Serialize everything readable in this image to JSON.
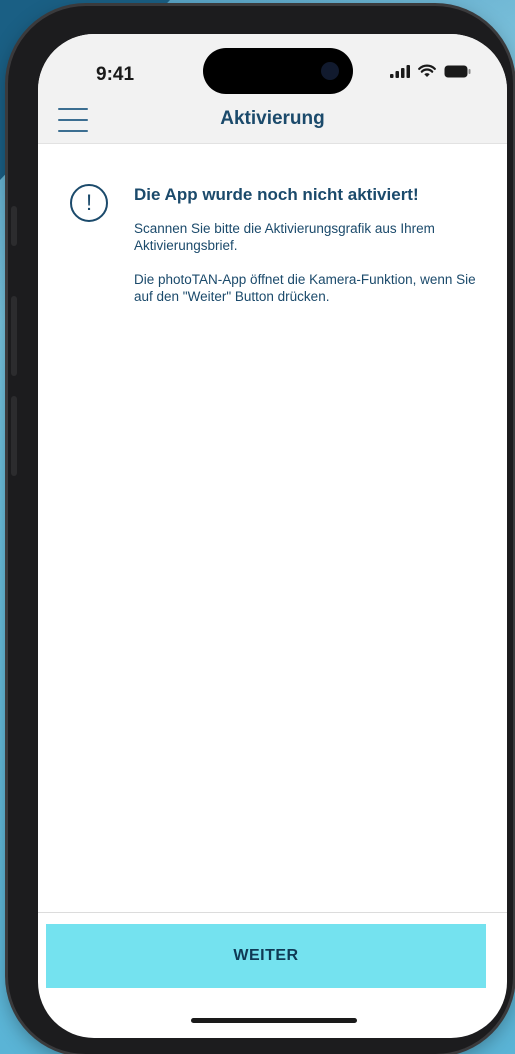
{
  "status_bar": {
    "time": "9:41",
    "icons": [
      "signal-icon",
      "wifi-icon",
      "battery-icon"
    ]
  },
  "nav": {
    "menu_icon": "hamburger-menu-icon",
    "title": "Aktivierung"
  },
  "notice": {
    "icon": "exclamation-circle-icon",
    "icon_glyph": "!",
    "heading": "Die App wurde noch nicht aktiviert!",
    "paragraph1": "Scannen Sie bitte die Aktivierungsgrafik aus Ihrem Aktivierungsbrief.",
    "paragraph2": "Die photoTAN-App öffnet die Kamera-Funktion, wenn Sie auf den \"Weiter\" Button drücken."
  },
  "footer": {
    "button_label": "WEITER"
  },
  "colors": {
    "accent_button": "#74e2ef",
    "text_primary": "#1b4a6b",
    "background": "#ffffff"
  }
}
